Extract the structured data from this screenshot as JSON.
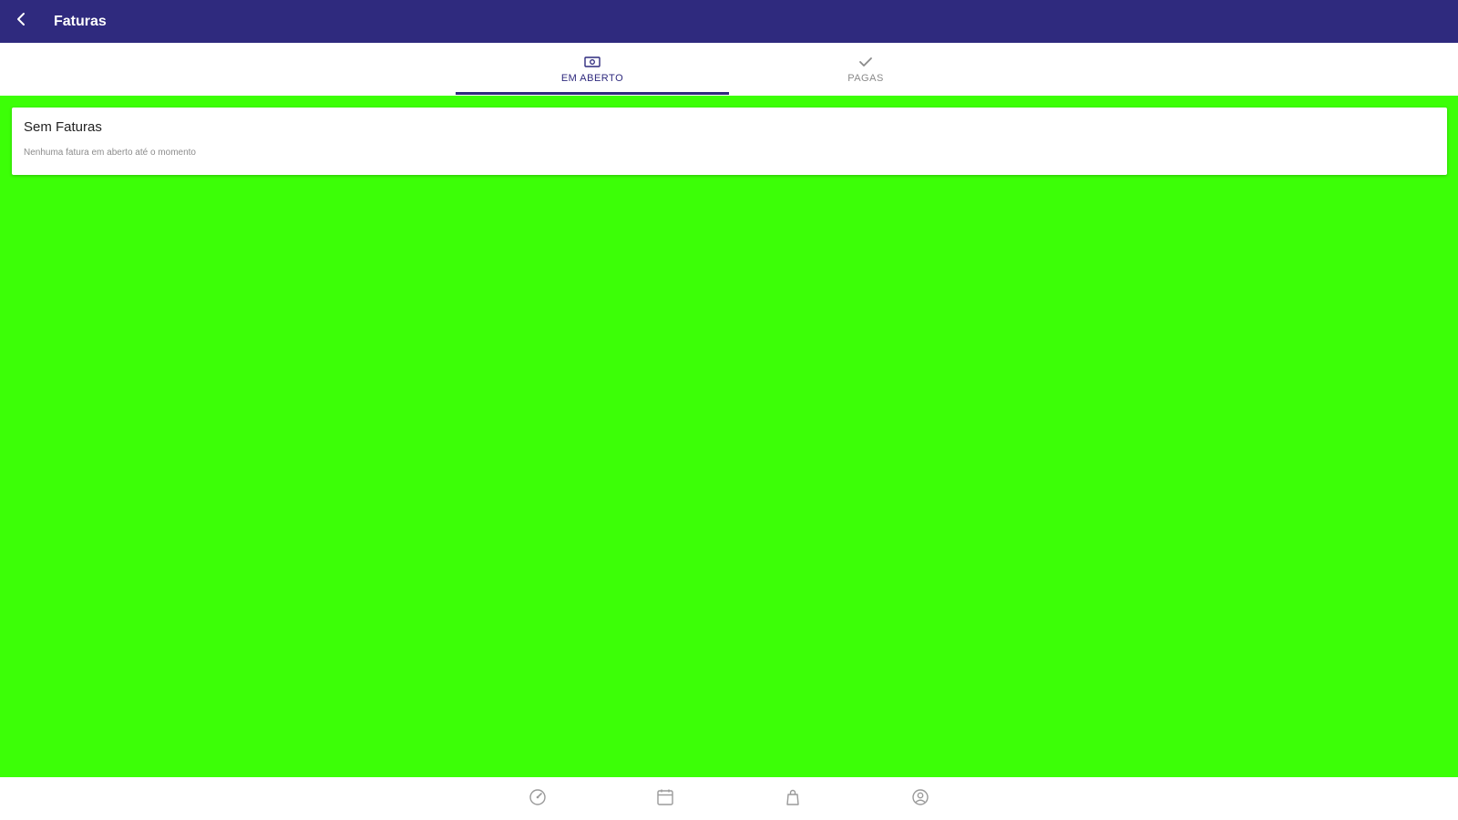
{
  "appbar": {
    "title": "Faturas",
    "back_icon": "arrow-back-icon",
    "background": "#2f2a7e"
  },
  "tabs": [
    {
      "label": "EM ABERTO",
      "icon": "cash-icon",
      "active": true
    },
    {
      "label": "PAGAS",
      "icon": "checkmark-icon",
      "active": false
    }
  ],
  "content": {
    "background": "#3cff07",
    "card": {
      "title": "Sem Faturas",
      "subtitle": "Nenhuma fatura em aberto até o momento"
    }
  },
  "bottom_nav": [
    {
      "icon": "speedometer-icon"
    },
    {
      "icon": "calendar-icon"
    },
    {
      "icon": "bag-icon"
    },
    {
      "icon": "account-icon"
    }
  ]
}
